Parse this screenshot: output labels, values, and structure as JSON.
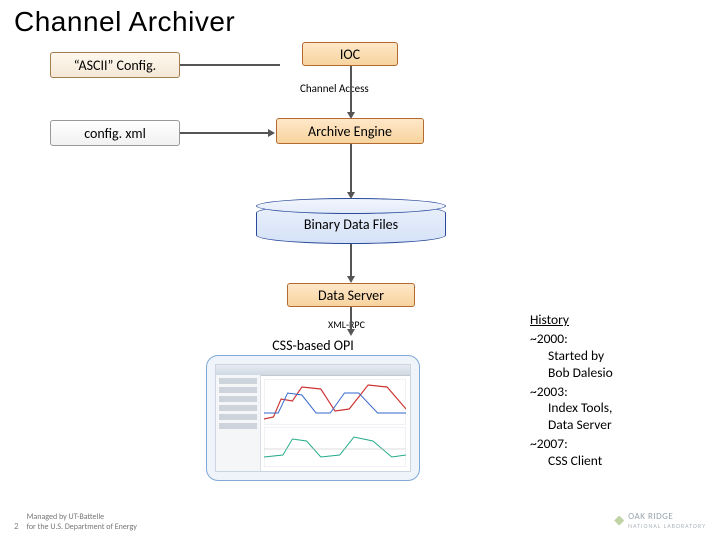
{
  "title": "Channel Archiver",
  "nodes": {
    "ascii_config": "“ASCII” Config.",
    "ioc": "IOC",
    "channel_access": "Channel Access",
    "config_xml": "config. xml",
    "archive_engine": "Archive Engine",
    "binary_files": "Binary Data Files",
    "data_server": "Data Server",
    "xml_rpc": "XML-RPC",
    "css_opi": "CSS-based OPI"
  },
  "history": {
    "heading": "History",
    "items": [
      {
        "year": "~2000:",
        "lines": [
          "Started by",
          "Bob Dalesio"
        ]
      },
      {
        "year": "~2003:",
        "lines": [
          "Index Tools,",
          "Data Server"
        ]
      },
      {
        "year": "~2007:",
        "lines": [
          "CSS Client"
        ]
      }
    ]
  },
  "footer": {
    "page": "2",
    "line1": "Managed by UT-Battelle",
    "line2": "for the U.S. Department of Energy",
    "logo_name": "OAK RIDGE",
    "logo_sub": "NATIONAL LABORATORY"
  }
}
